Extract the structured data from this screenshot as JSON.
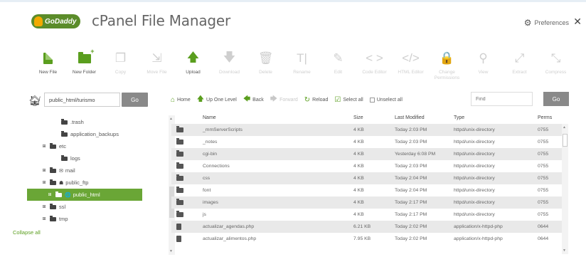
{
  "header": {
    "logo_text": "GoDaddy",
    "title": "cPanel File Manager",
    "preferences_label": "Preferences",
    "close_glyph": "✕"
  },
  "toolbar": [
    {
      "id": "new-file",
      "label": "New File",
      "enabled": true,
      "icon": "new-file-icon"
    },
    {
      "id": "new-folder",
      "label": "New Folder",
      "enabled": true,
      "icon": "new-folder-icon"
    },
    {
      "id": "copy",
      "label": "Copy",
      "enabled": false,
      "icon": "copy-icon",
      "glyph": "❐"
    },
    {
      "id": "move",
      "label": "Move File",
      "enabled": false,
      "icon": "move-icon",
      "glyph": "⇲"
    },
    {
      "id": "upload",
      "label": "Upload",
      "enabled": true,
      "icon": "upload-icon",
      "glyph": "🡅"
    },
    {
      "id": "download",
      "label": "Download",
      "enabled": false,
      "icon": "download-icon",
      "glyph": "🡇"
    },
    {
      "id": "delete",
      "label": "Delete",
      "enabled": false,
      "icon": "trash-icon",
      "glyph": "🗑"
    },
    {
      "id": "rename",
      "label": "Rename",
      "enabled": false,
      "icon": "rename-icon",
      "glyph": "T|"
    },
    {
      "id": "edit",
      "label": "Edit",
      "enabled": false,
      "icon": "edit-icon",
      "glyph": "✎"
    },
    {
      "id": "code-editor",
      "label": "Code Editor",
      "enabled": false,
      "icon": "code-icon",
      "glyph": "< >"
    },
    {
      "id": "html-editor",
      "label": "HTML Editor",
      "enabled": false,
      "icon": "html-icon",
      "glyph": "</>"
    },
    {
      "id": "permissions",
      "label": "Change Permissions",
      "enabled": false,
      "icon": "lock-icon",
      "glyph": "🔒"
    },
    {
      "id": "view",
      "label": "View",
      "enabled": false,
      "icon": "magnifier-icon",
      "glyph": "⚲"
    },
    {
      "id": "extract",
      "label": "Extract",
      "enabled": false,
      "icon": "extract-icon",
      "glyph": "⤢"
    },
    {
      "id": "compress",
      "label": "Compress",
      "enabled": false,
      "icon": "compress-icon",
      "glyph": "⤡"
    }
  ],
  "path": {
    "value": "public_html/turismo",
    "go_label": "Go"
  },
  "tree": {
    "items": [
      {
        "label": ".trash",
        "expander": "",
        "indent": 1,
        "extra": ""
      },
      {
        "label": "application_backups",
        "expander": "",
        "indent": 1,
        "extra": ""
      },
      {
        "label": "etc",
        "expander": "⊞",
        "indent": 0,
        "extra": ""
      },
      {
        "label": "logs",
        "expander": "",
        "indent": 1,
        "extra": ""
      },
      {
        "label": "mail",
        "expander": "⊞",
        "indent": 0,
        "extra": "✉"
      },
      {
        "label": "public_ftp",
        "expander": "⊞",
        "indent": 0,
        "extra": "☗"
      },
      {
        "label": "public_html",
        "expander": "⊞",
        "indent": 0,
        "extra": "🌐",
        "selected": true
      },
      {
        "label": "ssl",
        "expander": "⊞",
        "indent": 0,
        "extra": ""
      },
      {
        "label": "tmp",
        "expander": "⊞",
        "indent": 0,
        "extra": ""
      }
    ],
    "collapse_label": "Collapse all"
  },
  "nav": [
    {
      "label": "Home",
      "glyph": "⌂",
      "enabled": true
    },
    {
      "label": "Up One Level",
      "glyph": "🡅",
      "enabled": true
    },
    {
      "label": "Back",
      "glyph": "🡄",
      "enabled": true
    },
    {
      "label": "Forward",
      "glyph": "🡆",
      "enabled": false
    },
    {
      "label": "Reload",
      "glyph": "↻",
      "enabled": true
    },
    {
      "label": "Select all",
      "glyph": "☑",
      "enabled": true
    },
    {
      "label": "Unselect all",
      "glyph": "",
      "enabled": true,
      "checkbox": true
    }
  ],
  "find": {
    "placeholder": "Find",
    "go_label": "Go"
  },
  "table": {
    "columns": {
      "name": "Name",
      "size": "Size",
      "modified": "Last Modified",
      "type": "Type",
      "perms": "Perms"
    },
    "rows": [
      {
        "kind": "dir",
        "name": "_mmServerScripts",
        "size": "4 KB",
        "modified": "Today 2:03 PM",
        "type": "httpd/unix-directory",
        "perms": "0755"
      },
      {
        "kind": "dir",
        "name": "_notes",
        "size": "4 KB",
        "modified": "Today 2:03 PM",
        "type": "httpd/unix-directory",
        "perms": "0755"
      },
      {
        "kind": "dir",
        "name": "cgi-bin",
        "size": "4 KB",
        "modified": "Yesterday 6:08 PM",
        "type": "httpd/unix-directory",
        "perms": "0755"
      },
      {
        "kind": "dir",
        "name": "Connections",
        "size": "4 KB",
        "modified": "Today 2:03 PM",
        "type": "httpd/unix-directory",
        "perms": "0755"
      },
      {
        "kind": "dir",
        "name": "css",
        "size": "4 KB",
        "modified": "Today 2:04 PM",
        "type": "httpd/unix-directory",
        "perms": "0755"
      },
      {
        "kind": "dir",
        "name": "font",
        "size": "4 KB",
        "modified": "Today 2:04 PM",
        "type": "httpd/unix-directory",
        "perms": "0755"
      },
      {
        "kind": "dir",
        "name": "images",
        "size": "4 KB",
        "modified": "Today 2:17 PM",
        "type": "httpd/unix-directory",
        "perms": "0755"
      },
      {
        "kind": "dir",
        "name": "js",
        "size": "4 KB",
        "modified": "Today 2:17 PM",
        "type": "httpd/unix-directory",
        "perms": "0755"
      },
      {
        "kind": "file",
        "name": "actualizar_agendas.php",
        "size": "6.21 KB",
        "modified": "Today 2:02 PM",
        "type": "application/x-httpd-php",
        "perms": "0644"
      },
      {
        "kind": "file",
        "name": "actualizar_alimentos.php",
        "size": "7.95 KB",
        "modified": "Today 2:02 PM",
        "type": "application/x-httpd-php",
        "perms": "0644"
      }
    ]
  },
  "colors": {
    "accent": "#5a9e1e",
    "selected_bg": "#6aa636",
    "button_gray": "#898989"
  }
}
